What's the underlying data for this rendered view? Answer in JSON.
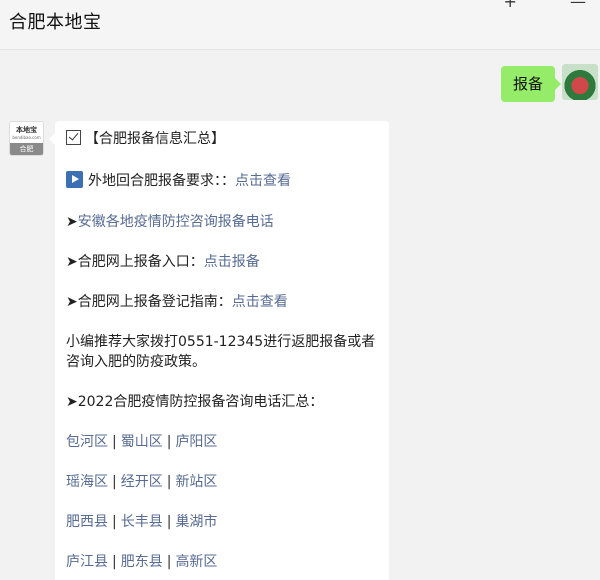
{
  "header": {
    "chat_title": "合肥本地宝",
    "action_1": "+",
    "action_2": "—"
  },
  "outgoing": {
    "text": "报备"
  },
  "bot_avatar": {
    "brand": "本地宝",
    "site": "bendibao.com",
    "city": "合肥"
  },
  "message": {
    "heading": "【合肥报备信息汇总】",
    "line_requirements_text": "外地回合肥报备要求：：",
    "line_requirements_link": "点击查看",
    "bullet": "➤",
    "line_phones_link": "安徽各地疫情防控咨询报备电话",
    "line_online_text": "合肥网上报备入口：",
    "line_online_link": "点击报备",
    "line_guide_text": "合肥网上报备登记指南：",
    "line_guide_link": "点击查看",
    "paragraph": "小编推荐大家拨打0551-12345进行返肥报备或者咨询入肥的防疫政策。",
    "line_summary_text": "2022合肥疫情防控报备咨询电话汇总：",
    "separator": "|",
    "district_rows": [
      [
        "包河区",
        "蜀山区",
        "庐阳区"
      ],
      [
        "瑶海区",
        "经开区",
        "新站区"
      ],
      [
        "肥西县",
        "长丰县",
        "巢湖市"
      ],
      [
        "庐江县",
        "肥东县",
        "高新区"
      ]
    ]
  },
  "colors": {
    "link": "#576b95",
    "outgoing_bubble": "#95ec69",
    "background": "#f2f2f2"
  },
  "icons": [
    "checkbox-icon",
    "play-icon",
    "arrow-bullet-icon"
  ]
}
